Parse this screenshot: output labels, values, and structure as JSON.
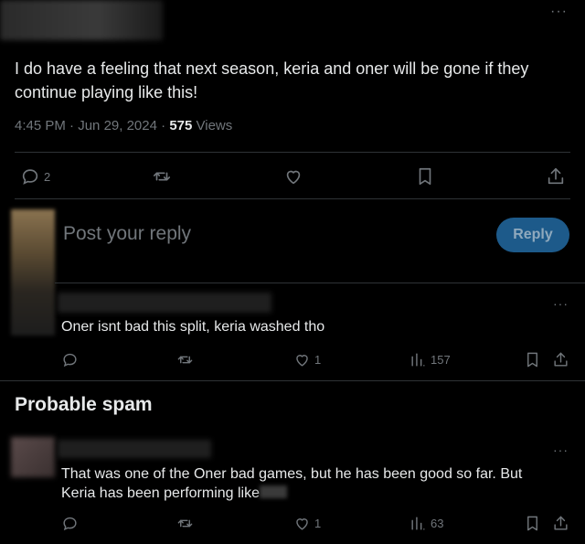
{
  "post": {
    "more_label": "···",
    "text": "I do have a feeling that next season, keria and oner will be gone if they continue playing like this!",
    "time": "4:45 PM",
    "date": "Jun 29, 2024",
    "views_count": "575",
    "views_label": "Views",
    "replies": "2",
    "retweets": "",
    "likes": ""
  },
  "compose": {
    "placeholder": "Post your reply",
    "button_label": "Reply"
  },
  "comments": [
    {
      "text": "Oner isnt bad this split, keria washed tho",
      "replies": "",
      "retweets": "",
      "likes": "1",
      "views": "157"
    },
    {
      "text": "That was one of the Oner bad games, but he has been good so far. But Keria has been performing like",
      "replies": "",
      "retweets": "",
      "likes": "1",
      "views": "63"
    }
  ],
  "section": {
    "title": "Probable spam"
  },
  "colors": {
    "background": "#000000",
    "text": "#e7e9ea",
    "muted": "#71767b",
    "divider": "#2f3336",
    "reply_button": "#1d5a8a"
  }
}
